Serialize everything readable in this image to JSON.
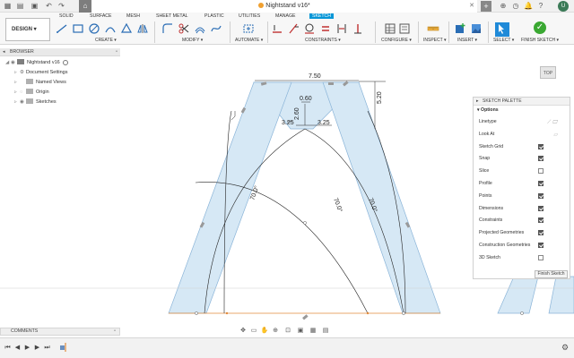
{
  "window": {
    "doc_title": "Nightstand v16*"
  },
  "toolbar": {
    "workspace": "DESIGN ▾",
    "tabs": [
      "SOLID",
      "SURFACE",
      "MESH",
      "SHEET METAL",
      "PLASTIC",
      "UTILITIES",
      "MANAGE",
      "SKETCH"
    ],
    "active_tab": "SKETCH",
    "groups": [
      "CREATE ▾",
      "MODIFY ▾",
      "AUTOMATE ▾",
      "CONSTRAINTS ▾",
      "CONFIGURE ▾",
      "INSPECT ▾",
      "INSERT ▾",
      "SELECT ▾",
      "FINISH SKETCH ▾"
    ]
  },
  "browser": {
    "title": "BROWSER",
    "root": "Nightstand v16",
    "items": [
      "Document Settings",
      "Named Views",
      "Origin",
      "Sketches"
    ]
  },
  "viewcube": {
    "face": "TOP"
  },
  "sketch_palette": {
    "title": "SKETCH PALETTE",
    "section": "Options",
    "options": [
      {
        "label": "Linetype",
        "type": "icons"
      },
      {
        "label": "Look At",
        "type": "icon"
      },
      {
        "label": "Sketch Grid",
        "checked": true
      },
      {
        "label": "Snap",
        "checked": true
      },
      {
        "label": "Slice",
        "checked": false
      },
      {
        "label": "Profile",
        "checked": true
      },
      {
        "label": "Points",
        "checked": true
      },
      {
        "label": "Dimensions",
        "checked": true
      },
      {
        "label": "Constraints",
        "checked": true
      },
      {
        "label": "Projected Geometries",
        "checked": true
      },
      {
        "label": "Construction Geometries",
        "checked": true
      },
      {
        "label": "3D Sketch",
        "checked": false
      }
    ],
    "finish_button": "Finish Sketch"
  },
  "sketch": {
    "dimensions": {
      "top_width": "7.50",
      "height_right": "5.20",
      "inner_top": "0.60",
      "inner_height": "2.60",
      "inner_left": "3.25",
      "inner_right": "3.25",
      "angle_left": "70.0°",
      "angle_mid": "70.0°",
      "angle_right": "70.0°"
    },
    "colors": {
      "profile_fill": "#d6e8f5",
      "profile_stroke": "#8ab4d8",
      "dimension_line": "#222222",
      "construction_line": "#e08a3c"
    }
  },
  "comments": {
    "title": "COMMENTS"
  }
}
